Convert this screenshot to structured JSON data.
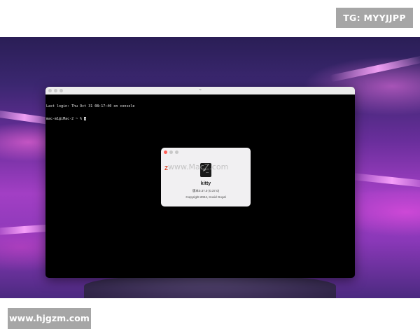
{
  "overlay": {
    "top_badge": "TG: MYYJJPP",
    "bottom_badge": "www.hjgzm.com"
  },
  "terminal": {
    "title": "~",
    "lines": [
      "Last login: Thu Oct 31 08:17:40 on console",
      "mac-m1@iMac-2 ~ % "
    ]
  },
  "about_dialog": {
    "watermark": "www.MacZ.com",
    "app_icon_glyph": ">_",
    "app_name": "kitty",
    "version": "版本0.37.0 (0.37.0)",
    "copyright": "Copyright 2024, Kovid Goyal",
    "colors": {
      "close": "#ff5f57",
      "minimize": "#c8c8c8",
      "zoom": "#c8c8c8"
    }
  }
}
